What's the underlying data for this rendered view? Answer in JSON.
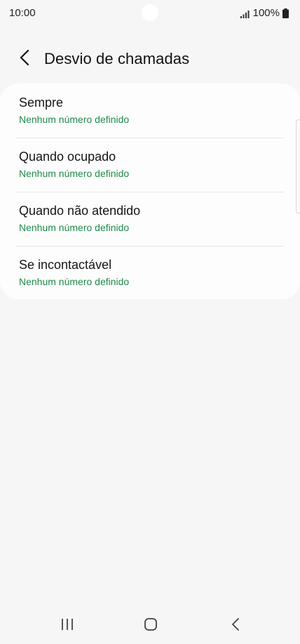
{
  "status_bar": {
    "time": "10:00",
    "battery": "100%",
    "signal_icon": "signal-icon",
    "battery_icon": "battery-icon"
  },
  "header": {
    "title": "Desvio de chamadas",
    "back_icon": "chevron-left-icon"
  },
  "list": {
    "items": [
      {
        "title": "Sempre",
        "subtitle": "Nenhum número definido"
      },
      {
        "title": "Quando ocupado",
        "subtitle": "Nenhum número definido"
      },
      {
        "title": "Quando não atendido",
        "subtitle": "Nenhum número definido"
      },
      {
        "title": "Se incontactável",
        "subtitle": "Nenhum número definido"
      }
    ]
  },
  "nav_bar": {
    "recents_icon": "recents-icon",
    "home_icon": "home-icon",
    "back_icon": "back-icon"
  },
  "colors": {
    "background": "#f6f6f6",
    "card": "#fdfdfd",
    "accent_green": "#1d8a4a"
  }
}
